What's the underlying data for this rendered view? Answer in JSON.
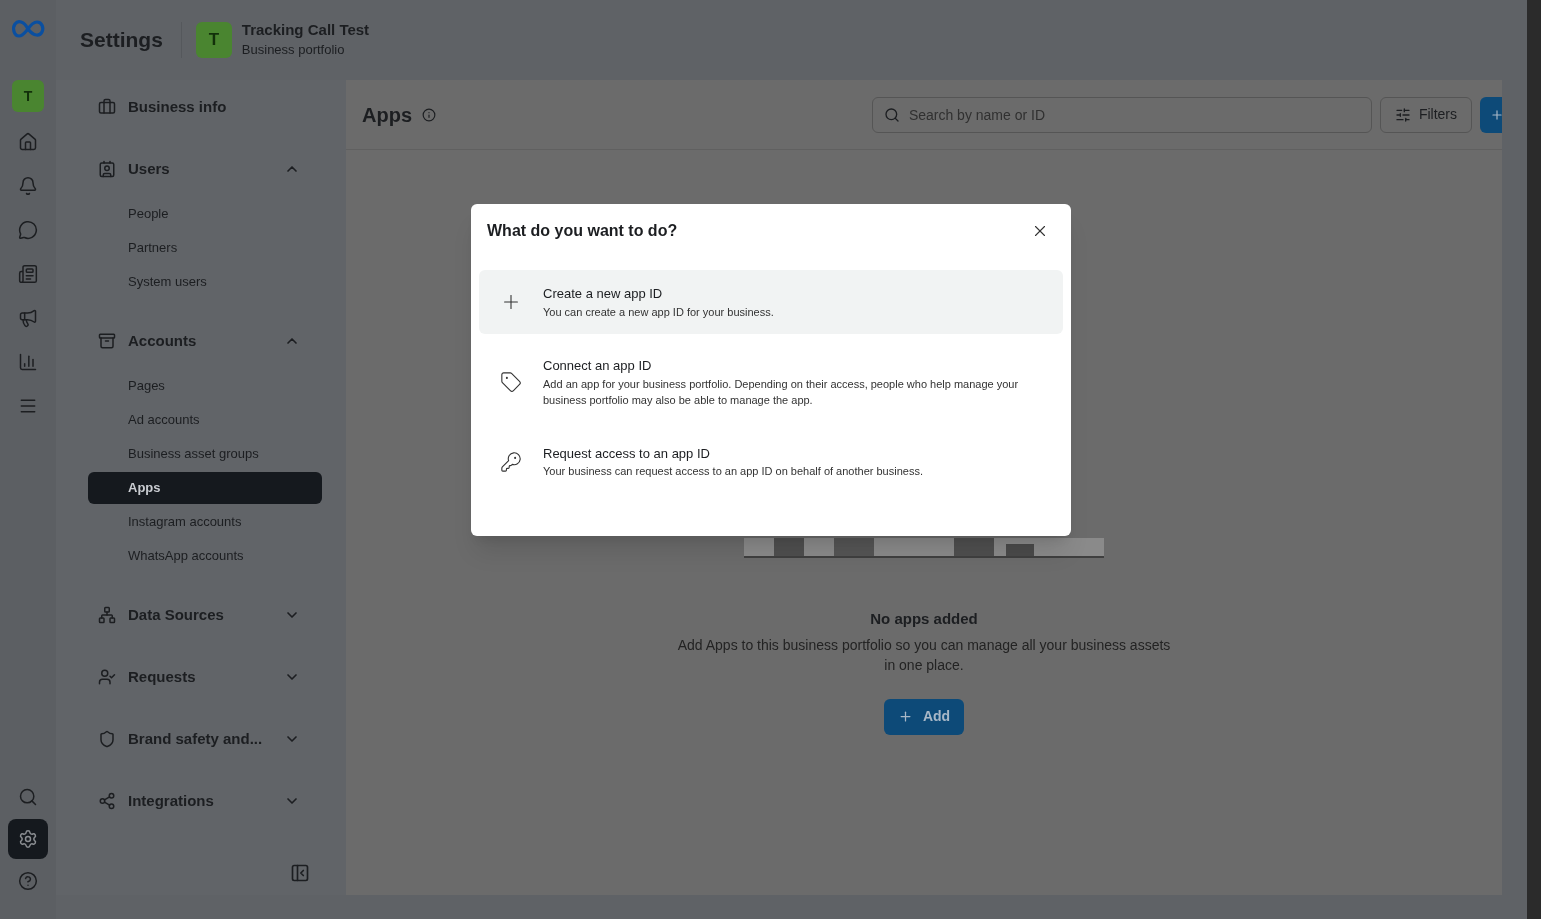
{
  "header": {
    "title": "Settings",
    "portfolio": {
      "initial": "T",
      "name": "Tracking Call Test",
      "subtitle": "Business portfolio"
    }
  },
  "rail": {
    "avatar": "T",
    "top": [
      {
        "kind": "home",
        "selected": false
      },
      {
        "kind": "bell",
        "selected": false
      },
      {
        "kind": "chat",
        "selected": false
      },
      {
        "kind": "cards",
        "selected": false
      },
      {
        "kind": "megaphone",
        "selected": false
      },
      {
        "kind": "chart",
        "selected": false
      },
      {
        "kind": "menu",
        "selected": false
      }
    ],
    "bottom": [
      {
        "kind": "search",
        "selected": false
      },
      {
        "kind": "settings",
        "selected": true
      },
      {
        "kind": "help",
        "selected": false
      }
    ]
  },
  "sidebar": {
    "sections": [
      {
        "kind": "link",
        "label": "Business info"
      },
      {
        "kind": "group",
        "label": "Users",
        "expanded": true,
        "children": [
          {
            "label": "People",
            "selected": false
          },
          {
            "label": "Partners",
            "selected": false
          },
          {
            "label": "System users",
            "selected": false
          }
        ]
      },
      {
        "kind": "group",
        "label": "Accounts",
        "expanded": true,
        "children": [
          {
            "label": "Pages",
            "selected": false
          },
          {
            "label": "Ad accounts",
            "selected": false
          },
          {
            "label": "Business asset groups",
            "selected": false
          },
          {
            "label": "Apps",
            "selected": true
          },
          {
            "label": "Instagram accounts",
            "selected": false
          },
          {
            "label": "WhatsApp accounts",
            "selected": false
          }
        ]
      },
      {
        "kind": "group",
        "label": "Data Sources",
        "expanded": false
      },
      {
        "kind": "group",
        "label": "Requests",
        "expanded": false
      },
      {
        "kind": "group",
        "label": "Brand safety and...",
        "expanded": false
      },
      {
        "kind": "group",
        "label": "Integrations",
        "expanded": false
      }
    ]
  },
  "main": {
    "title": "Apps",
    "search": {
      "placeholder": "Search by name or ID"
    },
    "filters": "Filters",
    "empty": {
      "title": "No apps added",
      "description": "Add Apps to this business portfolio so you can manage all your business assets in one place.",
      "button": "Add"
    }
  },
  "dialog": {
    "title": "What do you want to do?",
    "options": [
      {
        "title": "Create a new app ID",
        "description": "You can create a new app ID for your business.",
        "selected": true
      },
      {
        "title": "Connect an app ID",
        "description": "Add an app for your business portfolio. Depending on their access, people who help manage your business portfolio may also be able to manage the app.",
        "selected": false
      },
      {
        "title": "Request access to an app ID",
        "description": "Your business can request access to an app ID on behalf of another business.",
        "selected": false
      }
    ]
  }
}
